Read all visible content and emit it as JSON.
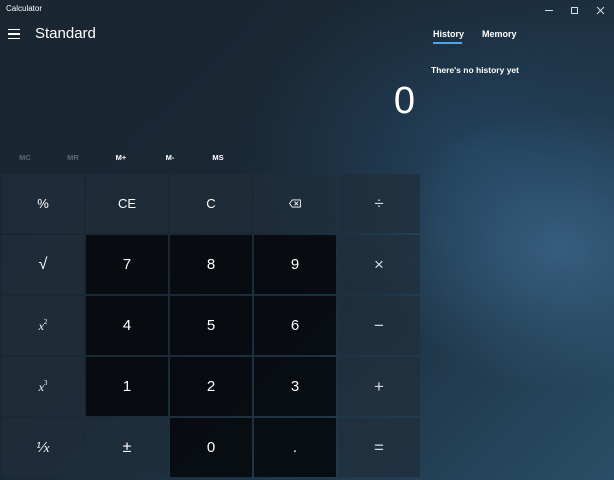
{
  "window": {
    "title": "Calculator"
  },
  "header": {
    "mode": "Standard"
  },
  "display": {
    "value": "0"
  },
  "memory": {
    "mc": "MC",
    "mr": "MR",
    "m_plus": "M+",
    "m_minus": "M-",
    "ms": "MS"
  },
  "keys": {
    "percent": "%",
    "ce": "CE",
    "c": "C",
    "divide": "÷",
    "sqrt": "√",
    "seven": "7",
    "eight": "8",
    "nine": "9",
    "multiply": "×",
    "square_base": "x",
    "square_exp": "2",
    "four": "4",
    "five": "5",
    "six": "6",
    "minus": "−",
    "cube_base": "x",
    "cube_exp": "3",
    "one": "1",
    "two": "2",
    "three": "3",
    "plus": "+",
    "reciprocal": "⅟x",
    "negate": "±",
    "zero": "0",
    "decimal": ".",
    "equals": "="
  },
  "panel": {
    "tab_history": "History",
    "tab_memory": "Memory",
    "active_tab": "History",
    "empty_message": "There's no history yet"
  },
  "colors": {
    "accent": "#4aa8e8",
    "number_key_bg": "#060a0e",
    "operator_key_bg": "#202e3a"
  },
  "icons": {
    "menu": "hamburger-menu-icon",
    "backspace": "backspace-icon",
    "minimize": "minimize-icon",
    "maximize": "maximize-icon",
    "close": "close-icon"
  }
}
